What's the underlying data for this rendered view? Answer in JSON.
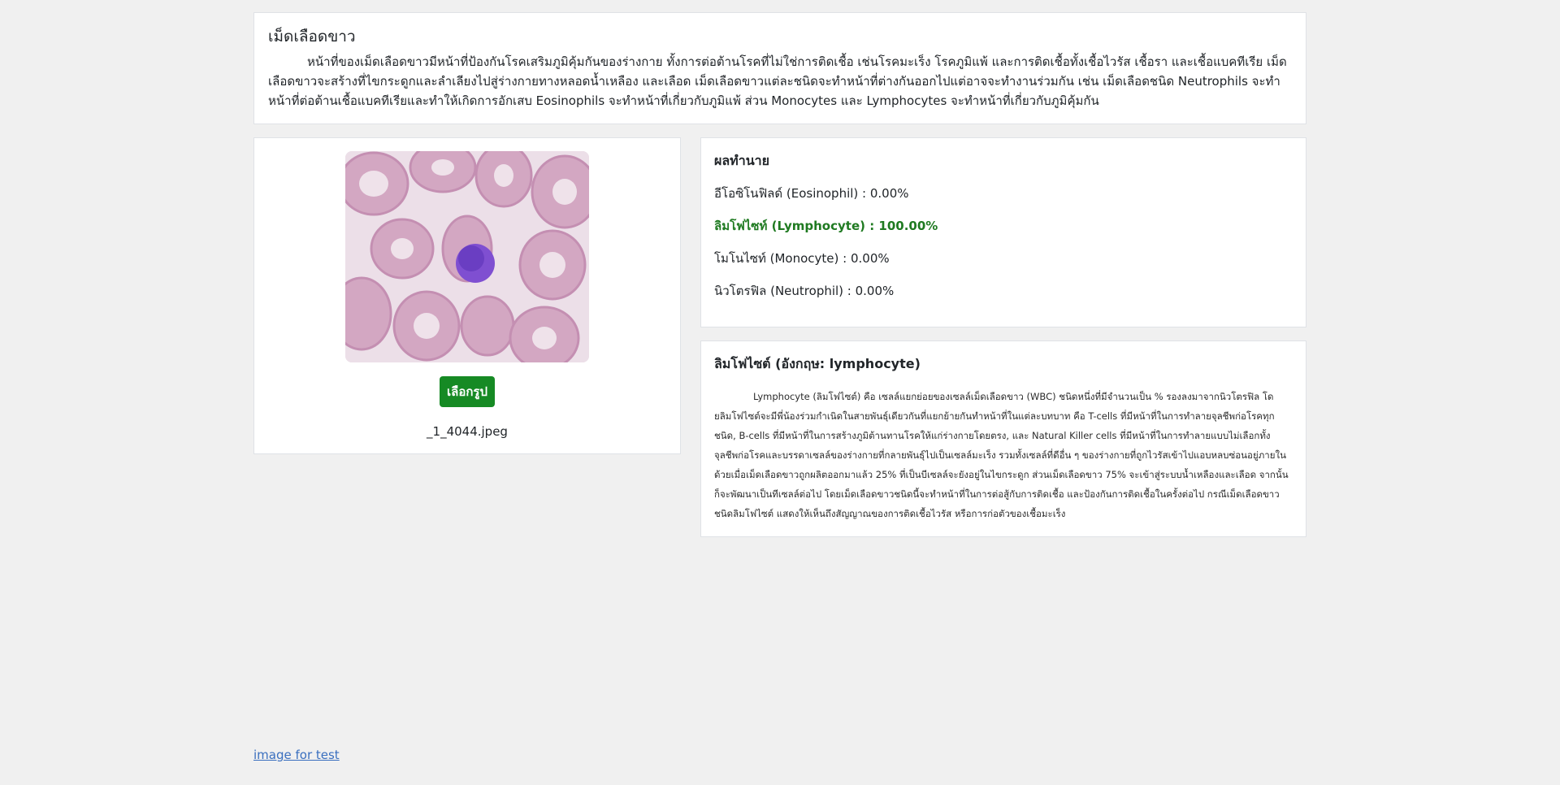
{
  "intro": {
    "title": "เม็ดเลือดขาว",
    "body": "หน้าที่ของเม็ดเลือดขาวมีหน้าที่ป้องกันโรคเสริมภูมิคุ้มกันของร่างกาย ทั้งการต่อต้านโรคที่ไม่ใช่การติดเชื้อ เช่นโรคมะเร็ง โรคภูมิแพ้ และการติดเชื้อทั้งเชื้อไวรัส เชื้อรา และเชื้อแบคทีเรีย เม็ดเลือดขาวจะสร้างที่ไขกระดูกและลำเลียงไปสู่ร่างกายทางหลอดน้ำเหลือง และเลือด เม็ดเลือดขาวแต่ละชนิดจะทำหน้าที่ต่างกันออกไปแต่อาจจะทำงานร่วมกัน เช่น เม็ดเลือดชนิด Neutrophils จะทำหน้าที่ต่อต้านเชื้อแบคทีเรียและทำให้เกิดการอักเสบ Eosinophils จะทำหน้าที่เกี่ยวกับภูมิแพ้ ส่วน Monocytes และ Lymphocytes จะทำหน้าที่เกี่ยวกับภูมิคุ้มกัน"
  },
  "upload": {
    "select_label": "เลือกรูป",
    "file_name": "_1_4044.jpeg",
    "colors": {
      "button": "#168a24"
    }
  },
  "results": {
    "title": "ผลทำนาย",
    "items": [
      {
        "text": "อีโอซิโนฟิลด์ (Eosinophil) : 0.00%",
        "top": false
      },
      {
        "text": "ลิมโฟไซท์ (Lymphocyte) : 100.00%",
        "top": true
      },
      {
        "text": "โมโนไซท์ (Monocyte) : 0.00%",
        "top": false
      },
      {
        "text": "นิวโตรฟิล (Neutrophil) : 0.00%",
        "top": false
      }
    ],
    "colors": {
      "top": "#1f7a21"
    }
  },
  "info": {
    "title": "ลิมโฟไซต์ (อังกฤษ: lymphocyte)",
    "body": "Lymphocyte (ลิมโฟไซต์) คือ เซลล์แยกย่อยของเซลล์เม็ดเลือดขาว (WBC) ชนิดหนึ่งที่มีจำนวนเป็น % รองลงมาจากนิวโตรฟิล โดยลิมโฟไซต์จะมีพี่น้องร่วมกำเนิดในสายพันธุ์เดียวกันที่แยกย้ายกันทำหน้าที่ในแต่ละบทบาท คือ T-cells ที่มีหน้าที่ในการทำลายจุลชีพก่อโรคทุกชนิด, B-cells ที่มีหน้าที่ในการสร้างภูมิต้านทานโรคให้แก่ร่างกายโดยตรง, และ Natural Killer cells ที่มีหน้าที่ในการทำลายแบบไม่เลือกทั้งจุลชีพก่อโรคและบรรดาเซลล์ของร่างกายที่กลายพันธุ์ไปเป็นเซลล์มะเร็ง รวมทั้งเซลล์ที่ดีอื่น ๆ ของร่างกายที่ถูกไวรัสเข้าไปแอบหลบซ่อนอยู่ภายในด้วยเมื่อเม็ดเลือดขาวถูกผลิตออกมาแล้ว 25% ที่เป็นบีเซลล์จะยังอยู่ในไขกระดูก ส่วนเม็ดเลือดขาว 75% จะเข้าสู่ระบบน้ำเหลืองและเลือด จากนั้นก็จะพัฒนาเป็นทีเซลล์ต่อไป โดยเม็ดเลือดขาวชนิดนี้จะทำหน้าที่ในการต่อสู้กับการติดเชื้อ และป้องกันการติดเชื้อในครั้งต่อไป กรณีเม็ดเลือดขาวชนิดลิมโฟไซต์ แสดงให้เห็นถึงสัญญาณของการติดเชื้อไวรัส หรือการก่อตัวของเชื้อมะเร็ง"
  },
  "footer": {
    "link_label": "image for test"
  }
}
